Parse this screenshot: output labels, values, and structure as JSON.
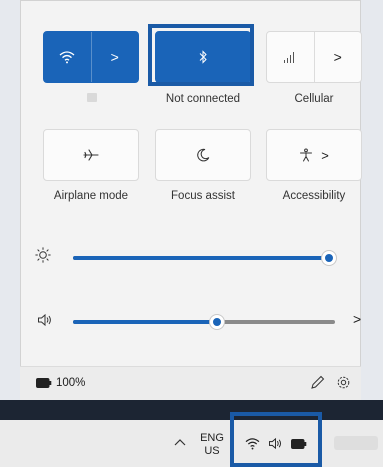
{
  "quick_settings": {
    "wifi_tile": {
      "icon": "wifi-icon",
      "expand_glyph": ">"
    },
    "bluetooth_tile": {
      "icon": "bluetooth-icon",
      "caption": "Not connected"
    },
    "cellular_tile": {
      "icon": "cellular-signal-icon",
      "expand_glyph": ">",
      "caption": "Cellular"
    },
    "airplane_tile": {
      "icon": "airplane-icon",
      "caption": "Airplane mode"
    },
    "focus_tile": {
      "icon": "moon-icon",
      "caption": "Focus assist"
    },
    "accessibility_tile": {
      "icon": "accessibility-icon",
      "expand_glyph": ">",
      "caption": "Accessibility"
    }
  },
  "brightness": {
    "icon": "brightness-icon",
    "level_percent": 100
  },
  "volume": {
    "icon": "speaker-icon",
    "level_percent": 55,
    "expand_glyph": ">"
  },
  "footer": {
    "battery_icon": "battery-icon",
    "battery_text": "100%",
    "edit_icon": "pencil-icon",
    "settings_icon": "gear-icon"
  },
  "taskbar": {
    "overflow_glyph": "^",
    "language_line1": "ENG",
    "language_line2": "US",
    "tray_icons": [
      "wifi-icon",
      "speaker-icon",
      "battery-icon"
    ]
  },
  "accent_color": "#1a64b8",
  "highlight_color": "#1a5aa6"
}
